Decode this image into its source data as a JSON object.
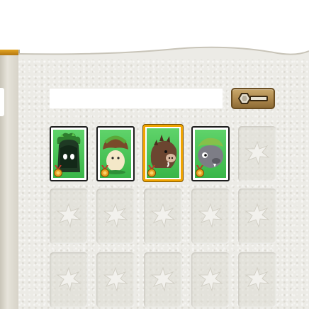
{
  "search": {
    "value": "",
    "placeholder": ""
  },
  "icons": {
    "search_button": "magnifier-icon",
    "empty_slot": "leaf-emblem-icon",
    "card_badge": "medal-icon"
  },
  "colors": {
    "page": "#ecebe6",
    "card_background": "#44c052",
    "card_border": "#1d1d1d",
    "selected_border": "#f0a400",
    "search_button": "#a9844a",
    "gold_trim": "#e3a422"
  },
  "cards": [
    {
      "monster": "dark-stump"
    },
    {
      "monster": "mushmom-sprout"
    },
    {
      "monster": "wild-boar"
    },
    {
      "monster": "iron-hog"
    }
  ],
  "selected_card_index": 2,
  "grid": {
    "columns": 5,
    "visible_rows": 3,
    "filled_slots": 4
  }
}
